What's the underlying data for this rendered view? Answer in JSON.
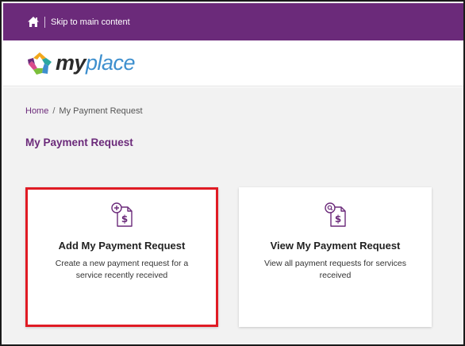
{
  "topbar": {
    "skip_link": "Skip to main content",
    "home_icon": "home-icon",
    "background": "#6b2a7a"
  },
  "header": {
    "logo": {
      "part1": "my",
      "part2": "place"
    }
  },
  "breadcrumb": {
    "home": "Home",
    "separator": "/",
    "current": "My Payment Request"
  },
  "page_title": "My Payment Request",
  "cards": [
    {
      "title": "Add My Payment Request",
      "description": "Create a new payment request for a service recently received",
      "icon": "add-payment-document-icon",
      "highlight_color": "#e01b24"
    },
    {
      "title": "View My Payment Request",
      "description": "View all payment requests for services received",
      "icon": "search-payment-document-icon"
    }
  ]
}
